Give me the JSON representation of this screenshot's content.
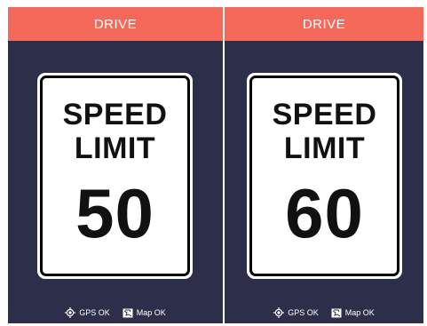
{
  "colors": {
    "header": "#f5695a",
    "background": "#2d2f4a",
    "sign": "#ffffff",
    "sign_text": "#111111"
  },
  "screens": [
    {
      "header_title": "DRIVE",
      "sign": {
        "line1": "SPEED",
        "line2": "LIMIT",
        "limit": "50"
      },
      "status": {
        "gps_icon": "gps-crosshair-icon",
        "gps_label": "GPS OK",
        "map_icon": "map-icon",
        "map_label": "Map OK"
      }
    },
    {
      "header_title": "DRIVE",
      "sign": {
        "line1": "SPEED",
        "line2": "LIMIT",
        "limit": "60"
      },
      "status": {
        "gps_icon": "gps-crosshair-icon",
        "gps_label": "GPS OK",
        "map_icon": "map-icon",
        "map_label": "Map OK"
      }
    }
  ]
}
